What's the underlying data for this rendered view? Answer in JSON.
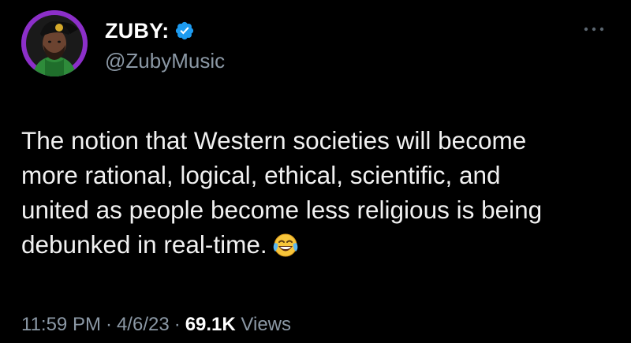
{
  "tweet": {
    "author": {
      "display_name": "ZUBY:",
      "handle": "@ZubyMusic",
      "verified": true,
      "avatar_ring_color": "#8c2fc9"
    },
    "text": "The notion that Western societies will become\nmore rational, logical, ethical, scientific, and\nunited as people become less religious is being\ndebunked in real-time.",
    "emoji": "face-with-tears-of-joy",
    "meta": {
      "time": "11:59 PM",
      "separator": "·",
      "date": "4/6/23",
      "views_count": "69.1K",
      "views_label": "Views"
    }
  },
  "colors": {
    "background": "#000000",
    "text": "#f1f1f1",
    "secondary_text": "#8b98a5",
    "verified_badge": "#1d9bf0"
  },
  "icons": {
    "more": "more-horizontal-icon",
    "verified": "verified-badge-icon"
  }
}
